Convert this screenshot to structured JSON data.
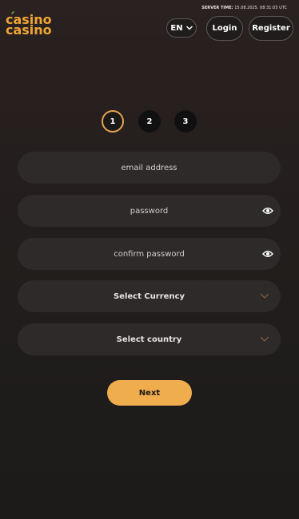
{
  "brand": {
    "logo_line1": "casino",
    "logo_line2": "casino",
    "accent_color": "#f0a536"
  },
  "header": {
    "server_time_label": "SERVER TIME:",
    "server_time_value": "15.08.2025. 08:31:05 UTC",
    "language": "EN",
    "login_label": "Login",
    "register_label": "Register"
  },
  "steps": [
    {
      "label": "1",
      "state": "active"
    },
    {
      "label": "2",
      "state": "inactive"
    },
    {
      "label": "3",
      "state": "inactive"
    }
  ],
  "form": {
    "email_placeholder": "email address",
    "password_placeholder": "password",
    "confirm_password_placeholder": "confirm password",
    "currency_select": "Select Currency",
    "country_select": "Select country",
    "next_label": "Next",
    "next_color": "#f0ad4e"
  },
  "icons": {
    "language_dropdown": "chevron-down-icon",
    "password_visibility": "eye-icon",
    "select_dropdown": "chevron-down-icon"
  }
}
